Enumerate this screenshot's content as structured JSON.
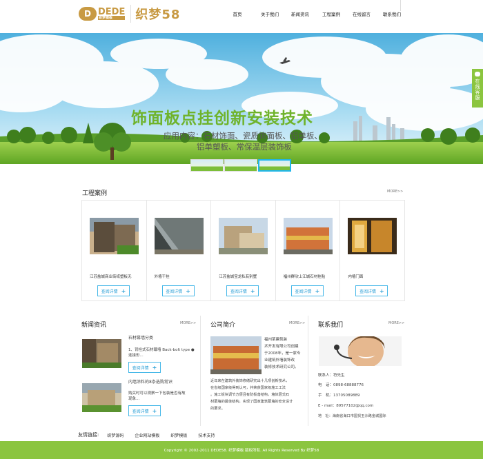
{
  "logo": {
    "badge": "D",
    "text": "DEDE",
    "sub": "织梦模板",
    "cn": "织梦58"
  },
  "nav": {
    "items": [
      "首页",
      "关于我们",
      "新闻资讯",
      "工程案例",
      "在线留言",
      "联系我们"
    ]
  },
  "banner": {
    "title": "饰面板点挂创新安装技术",
    "sub_line1": "应用内容：石材饰面、瓷质饰面板、铝单板、",
    "sub_line2": "铝单塑板、常保温层装饰板"
  },
  "side_tab": {
    "label": "在线客服"
  },
  "cases": {
    "title": "工程案例",
    "more": "MORE>>",
    "items": [
      {
        "title": "江苏盐城商业街纸塑板无",
        "button": "查阅详情"
      },
      {
        "title": "外墙干挂",
        "button": "查阅详情"
      },
      {
        "title": "江苏盐城宝龙私有别墅",
        "button": "查阅详情"
      },
      {
        "title": "福州群欣上江城石材挂贴",
        "button": "查阅详情"
      },
      {
        "title": "内墙门面",
        "button": "查阅详情"
      }
    ]
  },
  "news": {
    "title": "新闻资讯",
    "more": "MORE>>",
    "items": [
      {
        "title": "石材幕墙分类",
        "desc_line1": "1、背栓式石材幕墙 Back-bolt type ●",
        "desc_line2": "连接形...",
        "button": "查阅详情"
      },
      {
        "title": "内墙涂料的8条选购常识",
        "desc_line1": "购买时可以观察一下包装是否有故",
        "desc_line2": "现象...",
        "button": "查阅详情"
      }
    ]
  },
  "about": {
    "title": "公司简介",
    "more": "MORE>>",
    "lines": [
      "福州某建筑装",
      "术开发有限公司创建",
      "于2008年，是一家专",
      "业建筑外墙装饰改",
      "装修技术研究公司。",
      "近年来在建筑外装饰修缮研究出十几项创新技术，",
      "在省级国家级得到认可，并荣获国家级施工工法",
      "。施工板块调节方便且有防板落结构，墙体层式石",
      "材幕墙的最佳结构，实现了国家建筑幕墙的安全设计",
      "的要求。"
    ]
  },
  "contact": {
    "title": "联系我们",
    "more": "MORE>>",
    "person": "联系人：符先生",
    "phone": "电　话：0898-68888776",
    "mobile": "手　机：13705089889",
    "email": "E - mail：89577102@qq.com",
    "address": "地　址：海南省海口市国贸玉沙路金城国际"
  },
  "links": {
    "label": "友情链接:",
    "items": [
      "织梦源码",
      "企业网站模板",
      "织梦模板",
      "技术支持"
    ]
  },
  "footer": {
    "copyright": "Copyright © 2002-2011 DEDE58. 织梦模板 版权所有. All Rights Reserved By  织梦58"
  }
}
